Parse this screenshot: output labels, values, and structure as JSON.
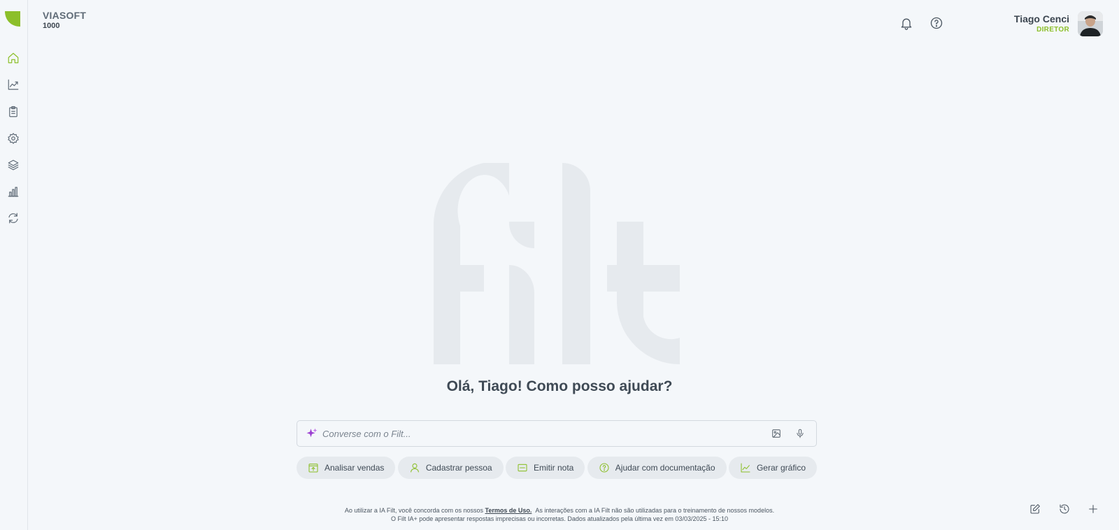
{
  "app": {
    "company_name": "VIASOFT",
    "company_code": "1000",
    "accent_color": "#8cbf2a"
  },
  "sidebar": {
    "items": [
      {
        "icon": "home-icon",
        "active": true
      },
      {
        "icon": "trend-chart-icon"
      },
      {
        "icon": "clipboard-icon"
      },
      {
        "icon": "gear-icon"
      },
      {
        "icon": "layers-icon"
      },
      {
        "icon": "bar-chart-icon"
      },
      {
        "icon": "sync-icon"
      }
    ]
  },
  "header": {
    "user_name": "Tiago Cenci",
    "user_role": "DIRETOR",
    "icons": [
      "bell-icon",
      "help-icon"
    ]
  },
  "main": {
    "greeting": "Olá, Tiago! Como posso ajudar?",
    "chat_placeholder": "Converse com o Filt...",
    "chat_value": "",
    "chips": [
      {
        "label": "Analisar vendas",
        "icon": "sales-icon"
      },
      {
        "label": "Cadastrar pessoa",
        "icon": "user-icon"
      },
      {
        "label": "Emitir nota",
        "icon": "invoice-icon"
      },
      {
        "label": "Ajudar com documentação",
        "icon": "help-circle-icon"
      },
      {
        "label": "Gerar gráfico",
        "icon": "chart-icon"
      }
    ]
  },
  "footer": {
    "line1_prefix": "Ao utilizar a IA Filt, você concorda com os nossos",
    "terms_link": "Termos de Uso.",
    "line1_suffix": "As interações com a IA Filt não são utilizadas para o treinamento de nossos modelos.",
    "line2": "O Filt IA+ pode apresentar respostas imprecisas ou incorretas. Dados atualizados pela última vez em 03/03/2025 - 15:10"
  }
}
